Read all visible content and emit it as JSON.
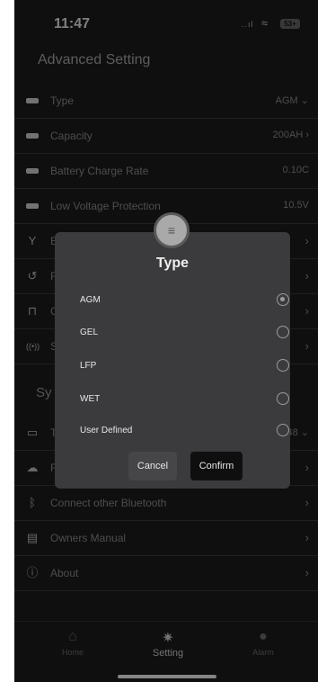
{
  "status": {
    "time": "11:47",
    "signal": "..ıl",
    "wifi": "≈",
    "battery": "53+"
  },
  "page_title": "Advanced Setting",
  "rows": [
    {
      "label": "Type",
      "value": "AGM",
      "icon": "battery-icon",
      "chevron": "⌄"
    },
    {
      "label": "Capacity",
      "value": "200AH",
      "icon": "battery-icon",
      "chevron": "›"
    },
    {
      "label": "Battery Charge Rate",
      "value": "0.10C",
      "icon": "battery-icon"
    },
    {
      "label": "Low Voltage Protection",
      "value": "10.5V",
      "icon": "battery-icon"
    },
    {
      "label": "E",
      "icon": "connector-icon",
      "chevron": "›"
    },
    {
      "label": "F",
      "icon": "history-icon",
      "chevron": "›"
    },
    {
      "label": "C",
      "icon": "lock-icon",
      "chevron": "›"
    },
    {
      "label": "S",
      "icon": "broadcast-icon",
      "chevron": "›"
    }
  ],
  "section_label": "Sy",
  "system_rows": [
    {
      "label": "T",
      "value": "48",
      "icon": "calendar-icon",
      "chevron": "⌄"
    },
    {
      "label": "F",
      "icon": "cloud-icon",
      "chevron": "›"
    },
    {
      "label": "Connect other Bluetooth",
      "icon": "bluetooth-icon",
      "chevron": "›"
    },
    {
      "label": "Owners Manual",
      "icon": "manual-icon",
      "chevron": "›"
    },
    {
      "label": "About",
      "icon": "info-icon",
      "chevron": "›"
    }
  ],
  "tabs": [
    {
      "label": "Home",
      "icon": "home-icon"
    },
    {
      "label": "Setting",
      "icon": "gear-icon"
    },
    {
      "label": "Alarm",
      "icon": "alert-icon"
    }
  ],
  "dialog": {
    "title": "Type",
    "options": [
      "AGM",
      "GEL",
      "LFP",
      "WET",
      "User Defined"
    ],
    "selected": "AGM",
    "cancel_label": "Cancel",
    "confirm_label": "Confirm"
  },
  "colors": {
    "background": "#1c1c1e",
    "dialog": "#3b3b3d",
    "confirm": "#0f0f10"
  }
}
